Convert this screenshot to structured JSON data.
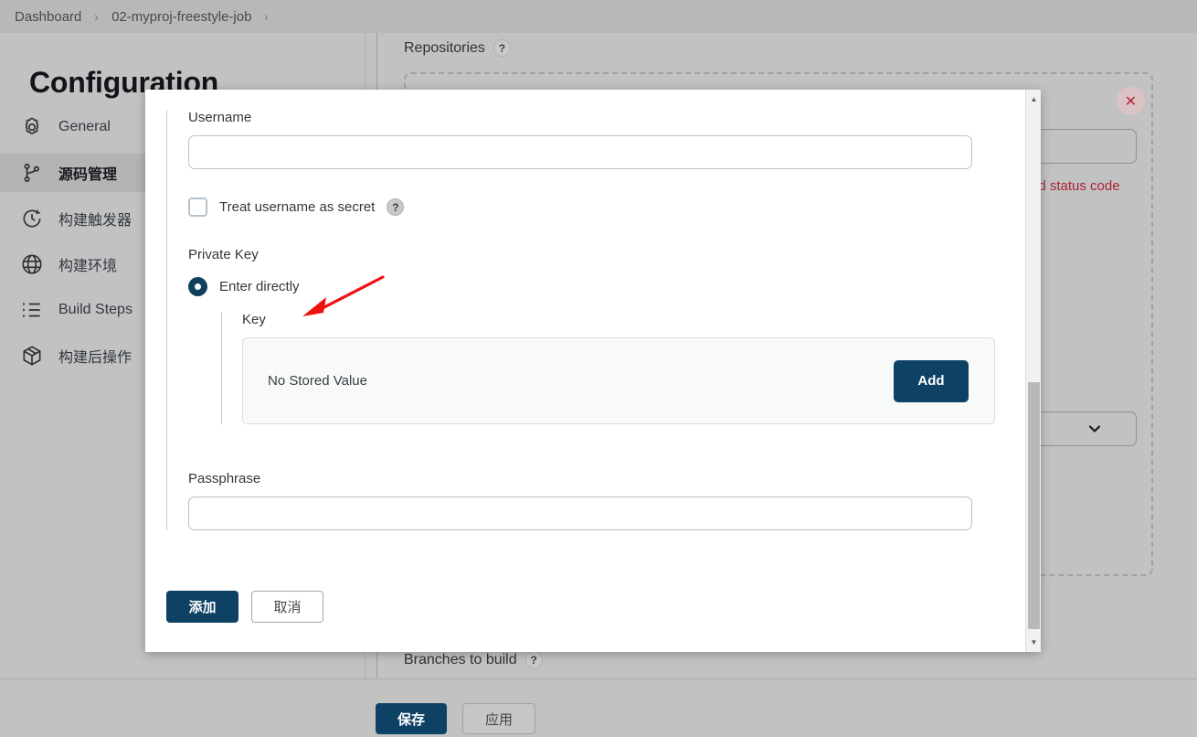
{
  "breadcrumb": {
    "items": [
      "Dashboard",
      "02-myproj-freestyle-job"
    ],
    "separator": "›"
  },
  "page": {
    "title": "Configuration"
  },
  "sidebar": {
    "items": [
      {
        "label": "General",
        "icon": "gear-icon",
        "active": false
      },
      {
        "label": "源码管理",
        "icon": "branch-icon",
        "active": true
      },
      {
        "label": "构建触发器",
        "icon": "clock-icon",
        "active": false
      },
      {
        "label": "构建环境",
        "icon": "globe-icon",
        "active": false
      },
      {
        "label": "Build Steps",
        "icon": "list-icon",
        "active": false
      },
      {
        "label": "构建后操作",
        "icon": "package-icon",
        "active": false
      }
    ]
  },
  "background": {
    "repositories_label": "Repositories",
    "help_glyph": "?",
    "close_glyph": "✕",
    "error_text": "ed status code",
    "branches_label": "Branches to build",
    "save_label": "保存",
    "apply_label": "应用"
  },
  "modal": {
    "username_label": "Username",
    "username_value": "",
    "username_placeholder": "",
    "treat_secret_label": "Treat username as secret",
    "treat_secret_help": "?",
    "treat_secret_checked": false,
    "private_key_label": "Private Key",
    "enter_directly_label": "Enter directly",
    "enter_directly_selected": true,
    "key_label": "Key",
    "no_stored_value_text": "No Stored Value",
    "add_key_label": "Add",
    "passphrase_label": "Passphrase",
    "passphrase_value": "",
    "passphrase_placeholder": "",
    "submit_label": "添加",
    "cancel_label": "取消",
    "scroll_up_glyph": "▲",
    "scroll_down_glyph": "▼"
  },
  "colors": {
    "accent_navy": "#0d4265",
    "overlay_gray": "#c2c2c2",
    "error_red": "#ab2439",
    "annotation_red": "#ee1111"
  }
}
